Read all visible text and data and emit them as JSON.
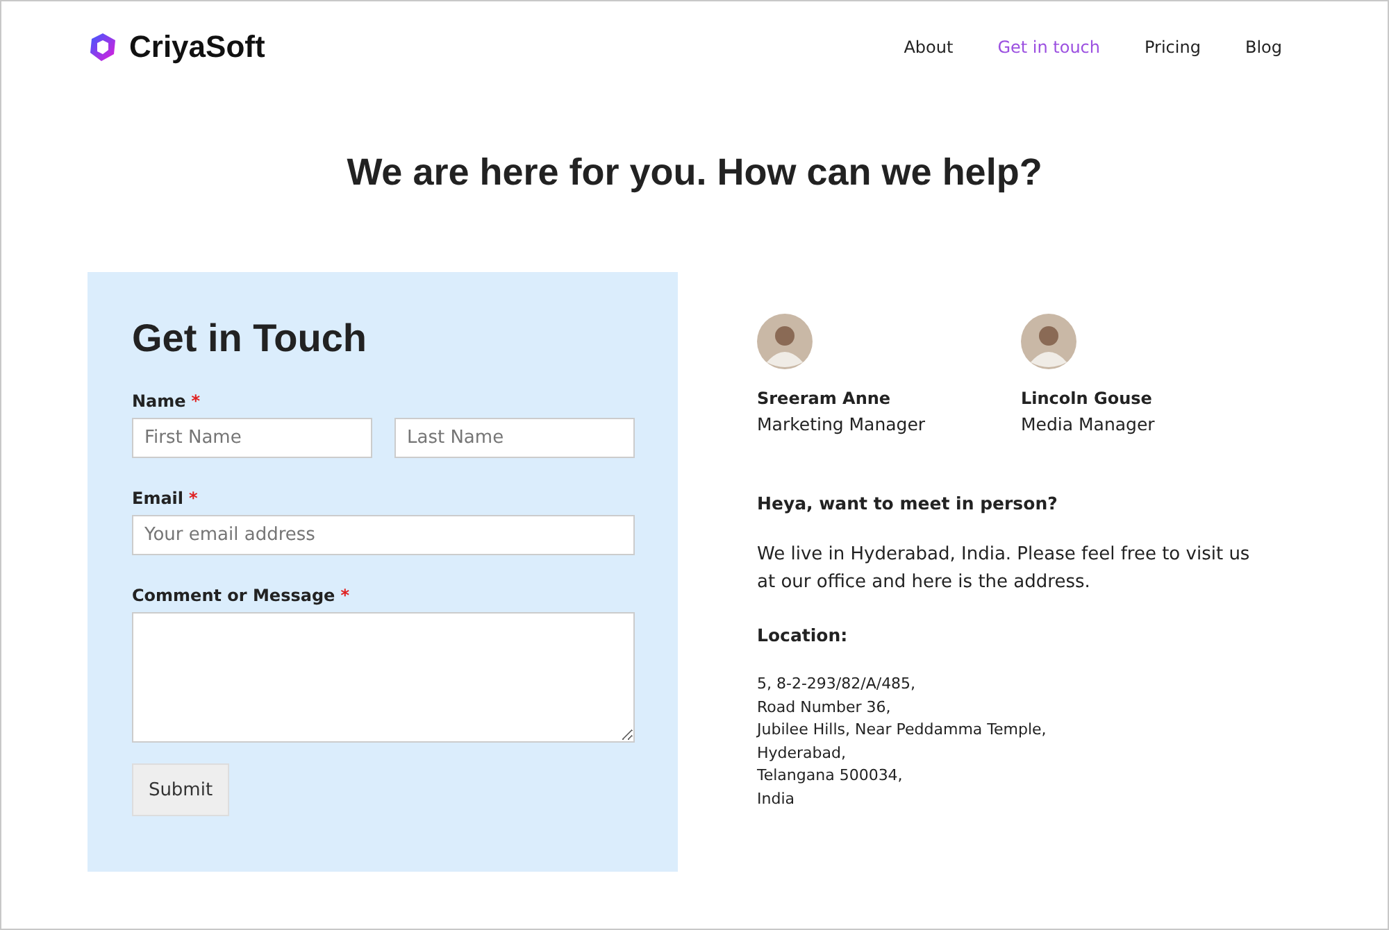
{
  "brand": {
    "name": "CriyaSoft"
  },
  "nav": [
    {
      "label": "About",
      "selected": false
    },
    {
      "label": "Get in touch",
      "selected": true
    },
    {
      "label": "Pricing",
      "selected": false
    },
    {
      "label": "Blog",
      "selected": false
    }
  ],
  "headline": "We are here for you. How can we help?",
  "form": {
    "title": "Get in Touch",
    "name": {
      "label": "Name",
      "required_mark": "*",
      "first_placeholder": "First Name",
      "last_placeholder": "Last Name"
    },
    "email": {
      "label": "Email",
      "required_mark": "*",
      "placeholder": "Your email address"
    },
    "message": {
      "label": "Comment or Message",
      "required_mark": "*"
    },
    "submit": "Submit"
  },
  "team": [
    {
      "name": "Sreeram Anne",
      "role": "Marketing Manager"
    },
    {
      "name": "Lincoln Gouse",
      "role": "Media Manager"
    }
  ],
  "meet": {
    "heading": "Heya, want to meet in person?",
    "text": "We live in Hyderabad, India. Please feel free to visit us at our office and here is the address.",
    "location_heading": "Location:",
    "address": [
      "5, 8-2-293/82/A/485,",
      "Road Number 36,",
      "Jubilee Hills, Near Peddamma Temple,",
      "Hyderabad,",
      "Telangana 500034,",
      "India"
    ]
  }
}
